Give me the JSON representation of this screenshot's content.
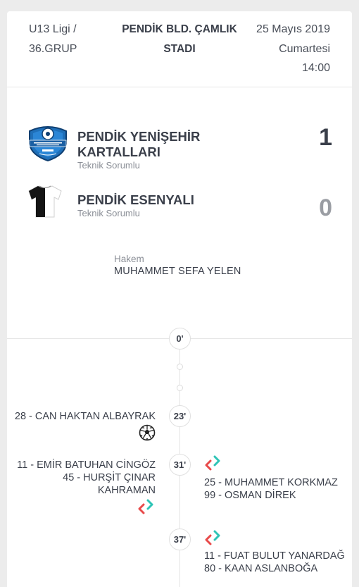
{
  "match": {
    "league_line1": "U13 Ligi /",
    "league_line2": "36.GRUP",
    "stadium_line1": "PENDİK BLD. ÇAMLIK",
    "stadium_line2": "STADI",
    "date": "25 Mayıs 2019",
    "day": "Cumartesi",
    "time": "14:00"
  },
  "home": {
    "name_line1": "PENDİK YENİŞEHİR",
    "name_line2": "KARTALLARI",
    "coach_label": "Teknik Sorumlu",
    "score": "1",
    "color": "#3a3f4a"
  },
  "away": {
    "name": "PENDİK ESENYALI",
    "coach_label": "Teknik Sorumlu",
    "score": "0",
    "color": "#9a9da3"
  },
  "referee": {
    "label": "Hakem",
    "name": "MUHAMMET SEFA YELEN"
  },
  "timeline": {
    "start": "0'",
    "events": [
      {
        "minute": "23'",
        "type": "goal-icon",
        "left": [
          "28 - CAN HAKTAN ALBAYRAK"
        ]
      },
      {
        "minute": "31'",
        "type": "substitution-icon",
        "left": [
          "11 - EMİR BATUHAN CİNGÖZ",
          "45 - HURŞİT ÇINAR",
          "KAHRAMAN"
        ],
        "right": [
          "25 - MUHAMMET KORKMAZ",
          "99 - OSMAN DİREK"
        ]
      },
      {
        "minute": "37'",
        "type": "substitution-icon",
        "right": [
          "11 - FUAT BULUT YANARDAĞ",
          "80 - KAAN ASLANBOĞA"
        ]
      }
    ]
  },
  "colors": {
    "sub_in": "#2ec4b6",
    "sub_out": "#e84a4a"
  }
}
